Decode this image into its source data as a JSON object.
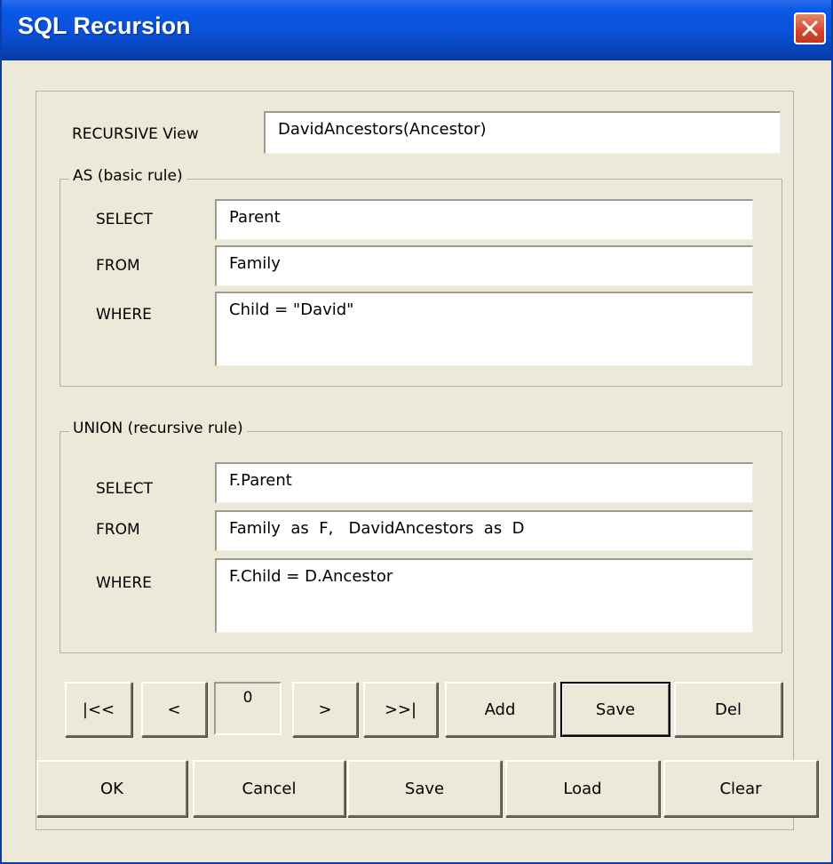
{
  "window": {
    "title": "SQL Recursion"
  },
  "view": {
    "label": "RECURSIVE View",
    "value": "DavidAncestors(Ancestor)"
  },
  "basic_rule": {
    "legend": "AS (basic rule)",
    "select_label": "SELECT",
    "select_value": "Parent",
    "from_label": "FROM",
    "from_value": "Family",
    "where_label": "WHERE",
    "where_value": "Child = \"David\""
  },
  "recursive_rule": {
    "legend": "UNION (recursive rule)",
    "select_label": "SELECT",
    "select_value": "F.Parent",
    "from_label": "FROM",
    "from_value": "Family  as  F,   DavidAncestors  as  D",
    "where_label": "WHERE",
    "where_value": "F.Child = D.Ancestor"
  },
  "nav": {
    "first": "|<<",
    "prev": "<",
    "record": "0",
    "next": ">",
    "last": ">>|",
    "add": "Add",
    "save": "Save",
    "del": "Del"
  },
  "footer": {
    "ok": "OK",
    "cancel": "Cancel",
    "save": "Save",
    "load": "Load",
    "clear": "Clear"
  }
}
